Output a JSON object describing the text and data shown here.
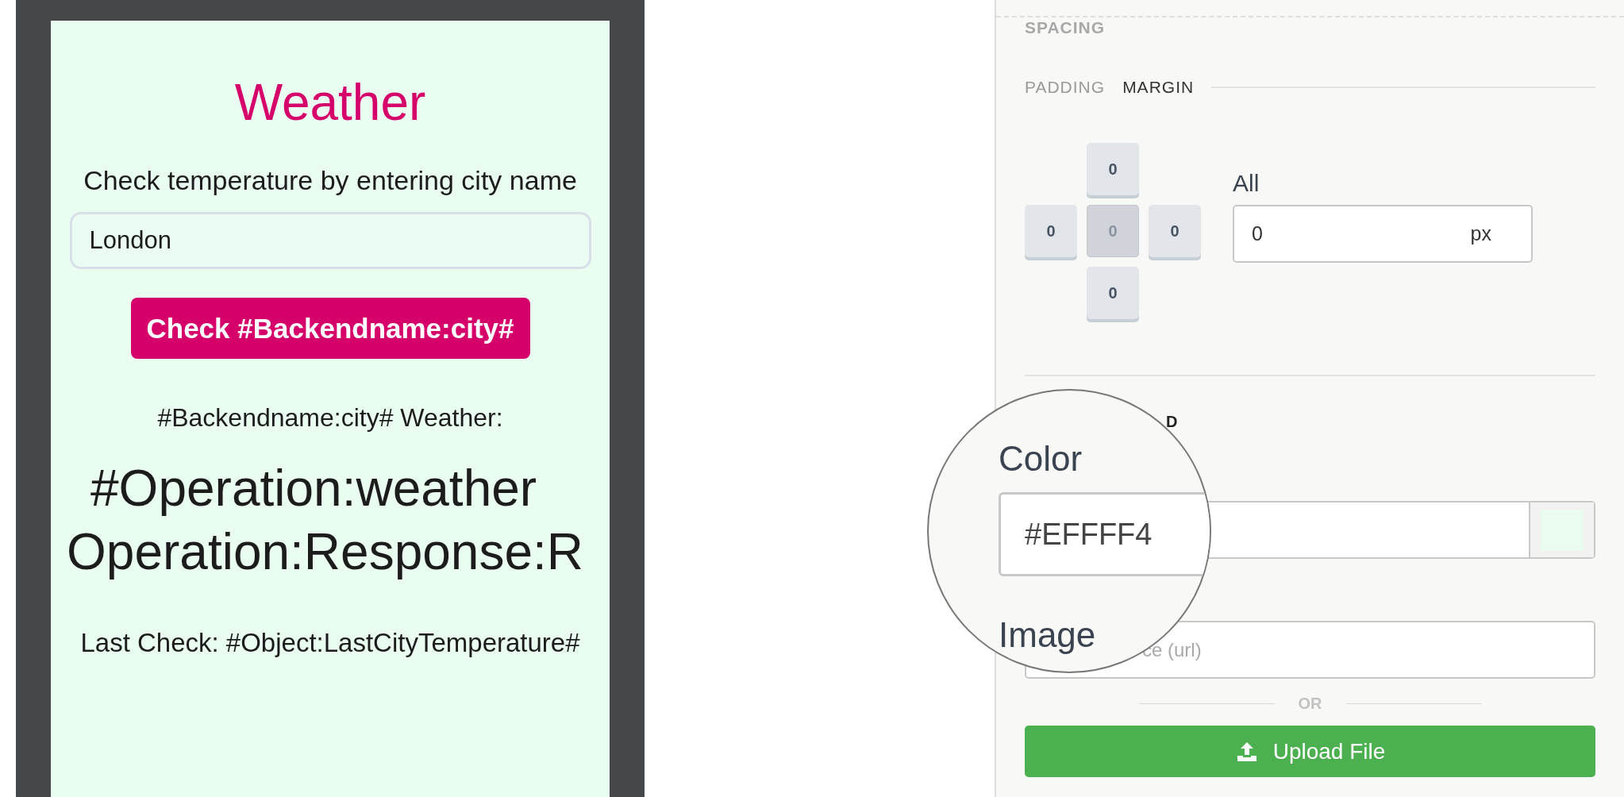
{
  "preview": {
    "title": "Weather",
    "subtitle": "Check temperature by entering city name",
    "city_field": {
      "value": "London"
    },
    "check_button": "Check #Backendname:city#",
    "result_label": "#Backendname:city# Weather:",
    "result_lines": [
      "#Operation:weather",
      "Operation:Response:R"
    ],
    "last_check": "Last Check: #Object:LastCityTemperature#"
  },
  "panel": {
    "section_title": "SPACING",
    "tabs": [
      {
        "label": "PADDING",
        "selected": false
      },
      {
        "label": "MARGIN",
        "selected": true
      }
    ],
    "box_buttons": [
      {
        "value": "0",
        "selected": false
      },
      {
        "value": "0",
        "selected": false
      },
      {
        "value": "0",
        "selected": true
      },
      {
        "value": "0",
        "selected": false
      },
      {
        "value": "0",
        "selected": false
      }
    ],
    "all_label": "All",
    "all_field": {
      "value": "0",
      "unit": "px"
    },
    "background_title": "D",
    "image_field": {
      "placeholder": "ce (url)"
    },
    "or_label": "OR",
    "upload_button": "Upload File"
  },
  "magnifier": {
    "color_label": "Color",
    "color_value": "#EFFFF4",
    "image_label": "Image"
  }
}
